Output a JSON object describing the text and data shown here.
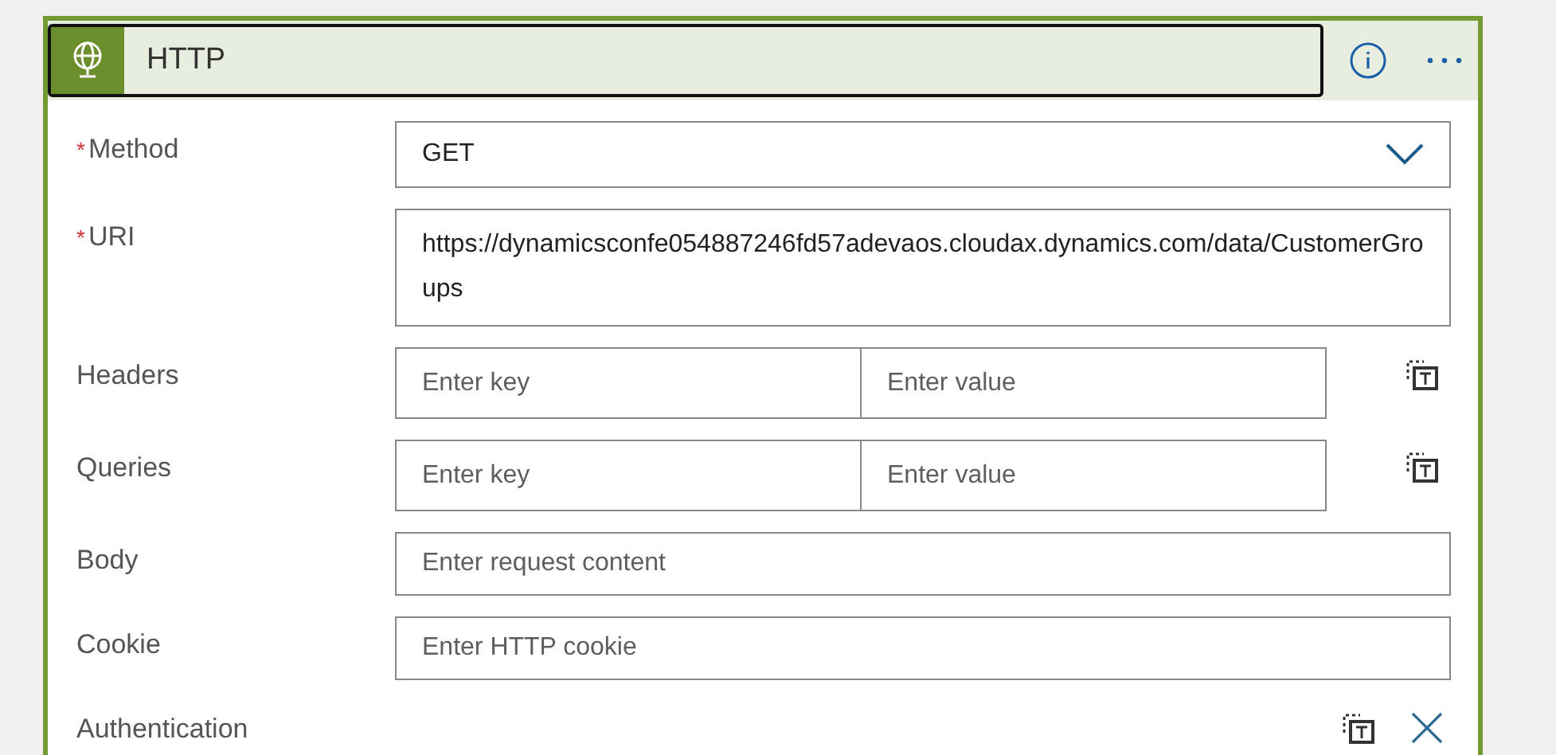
{
  "action": {
    "title": "HTTP"
  },
  "fields": [
    {
      "kind": "dropdown",
      "label": "Method",
      "required_mark": "*",
      "value": "GET"
    },
    {
      "kind": "multiline",
      "label": "URI",
      "required_mark": "*",
      "value": "https://dynamicsconfe054887246fd57adevaos.cloudax.dynamics.com/data/CustomerGroups"
    },
    {
      "kind": "keyvalue",
      "label": "Headers",
      "key_placeholder": "Enter key",
      "value_placeholder": "Enter value"
    },
    {
      "kind": "keyvalue",
      "label": "Queries",
      "key_placeholder": "Enter key",
      "value_placeholder": "Enter value"
    },
    {
      "kind": "text",
      "label": "Body",
      "placeholder": "Enter request content"
    },
    {
      "kind": "text",
      "label": "Cookie",
      "placeholder": "Enter HTTP cookie"
    },
    {
      "kind": "auth",
      "label": "Authentication"
    }
  ]
}
